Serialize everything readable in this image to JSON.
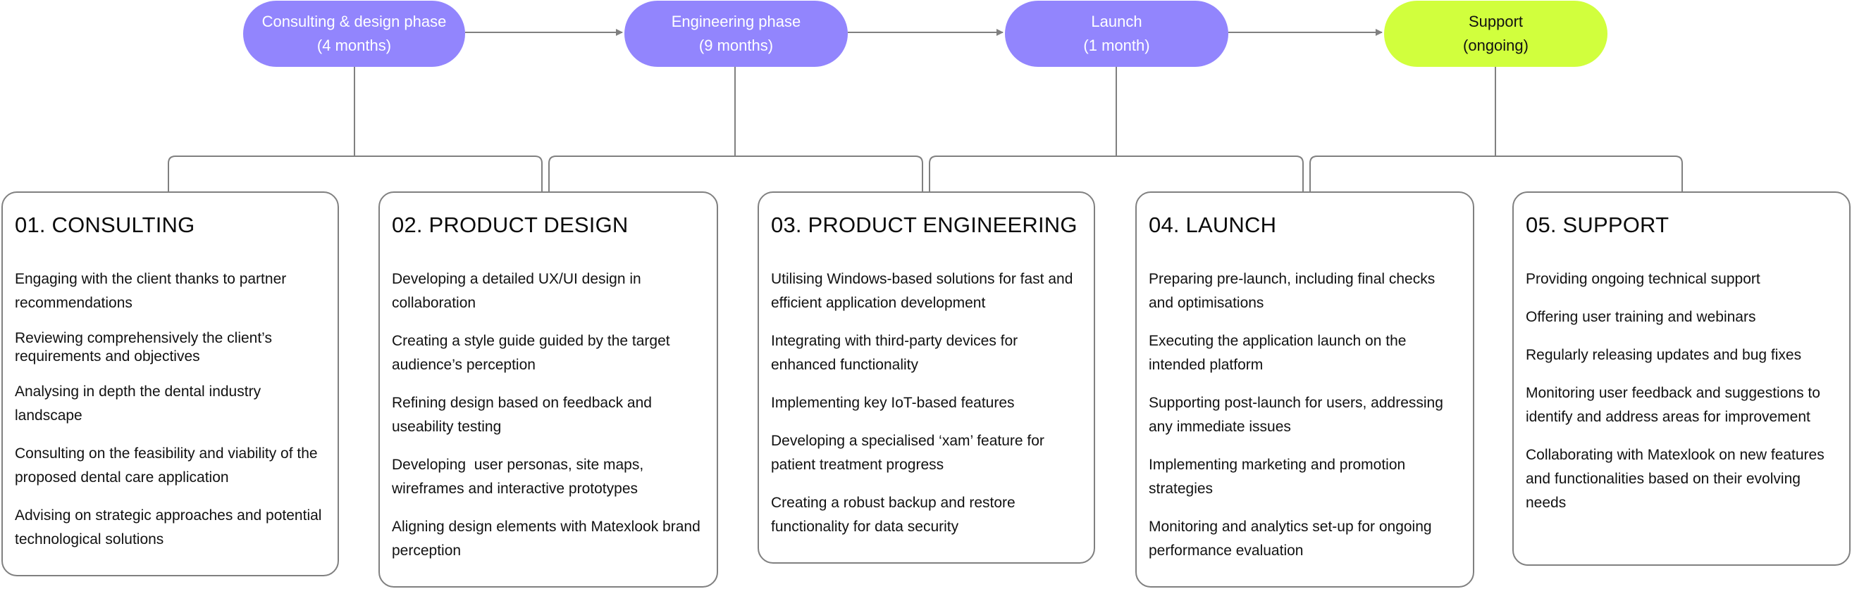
{
  "diagram": {
    "line_color": "#808080",
    "phases": [
      {
        "line1": "Consulting & design phase",
        "line2": "(4 months)",
        "color": "#9285FD",
        "text_color": "#FFFFFF"
      },
      {
        "line1": "Engineering phase",
        "line2": "(9 months)",
        "color": "#9285FD",
        "text_color": "#FFFFFF"
      },
      {
        "line1": "Launch",
        "line2": "(1 month)",
        "color": "#9285FD",
        "text_color": "#FFFFFF"
      },
      {
        "line1": "Support",
        "line2": "(ongoing)",
        "color": "#D1FF3D",
        "text_color": "#111111"
      }
    ],
    "stages": [
      {
        "title": "01. CONSULTING",
        "items": [
          "Engaging with the client thanks to partner recommendations",
          "Reviewing comprehensively the client’s requirements and objectives",
          "Analysing in depth the dental industry landscape",
          "Consulting on the feasibility and viability of the proposed dental care application",
          "Advising on strategic approaches and potential technological solutions"
        ]
      },
      {
        "title": "02. PRODUCT DESIGN",
        "items": [
          "Developing a detailed UX/UI design in collaboration",
          "Creating a style guide guided by the target audience’s perception",
          "Refining design based on feedback and useability testing",
          "Developing  user personas, site maps, wireframes and interactive prototypes",
          "Aligning design elements with Matexlook brand perception"
        ]
      },
      {
        "title": "03. PRODUCT ENGINEERING",
        "items": [
          "Utilising Windows-based solutions for fast and efficient application development",
          "Integrating with third-party devices for enhanced functionality",
          "Implementing key IoT-based features",
          "Developing a specialised ‘xam’ feature for patient treatment progress",
          "Creating a robust backup and restore functionality for data security"
        ]
      },
      {
        "title": "04. LAUNCH",
        "items": [
          "Preparing pre-launch, including final checks and optimisations",
          "Executing the application launch on the intended platform",
          "Supporting post-launch for users, addressing any immediate issues",
          "Implementing marketing and promotion strategies",
          "Monitoring and analytics set-up for ongoing performance evaluation"
        ]
      },
      {
        "title": "05. SUPPORT",
        "items": [
          "Providing ongoing technical support",
          "Offering user training and webinars",
          "Regularly releasing updates and bug fixes",
          "Monitoring user feedback and suggestions to identify and address areas for improvement",
          "Collaborating with Matexlook on new features and functionalities based on their evolving needs"
        ]
      }
    ]
  }
}
